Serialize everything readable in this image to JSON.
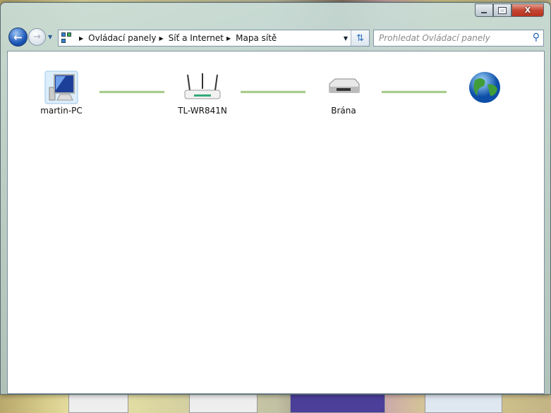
{
  "window": {
    "minimize": "minimize",
    "maximize": "maximize",
    "close": "X"
  },
  "address": {
    "crumbs": [
      "Ovládací panely",
      "Síť a Internet",
      "Mapa sítě"
    ]
  },
  "search": {
    "placeholder": "Prohledat Ovládací panely"
  },
  "map": {
    "nodes": [
      {
        "label": "martin-PC",
        "icon": "computer-icon"
      },
      {
        "label": "TL-WR841N",
        "icon": "router-icon"
      },
      {
        "label": "Brána",
        "icon": "gateway-icon"
      },
      {
        "label": "",
        "icon": "internet-globe-icon"
      }
    ],
    "link_color": "#7fb35a"
  }
}
